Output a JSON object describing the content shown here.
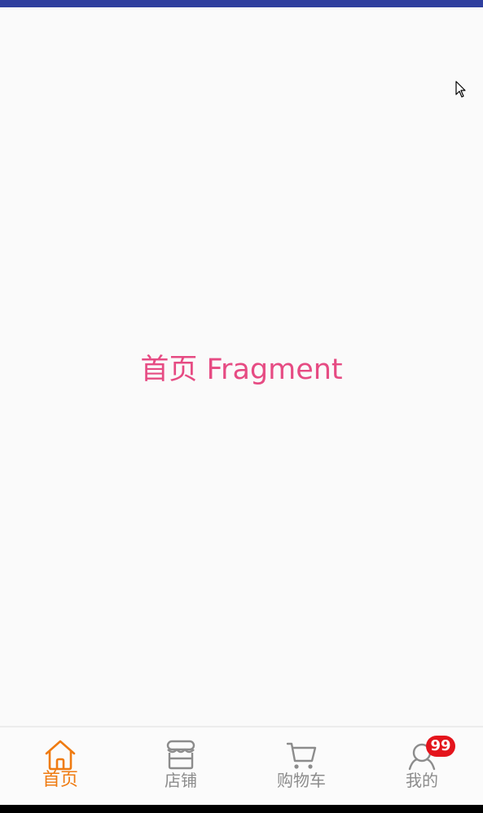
{
  "content": {
    "fragment_text": "首页 Fragment"
  },
  "bottom_nav": {
    "items": [
      {
        "label": "首页",
        "icon": "home-icon",
        "active": true
      },
      {
        "label": "店铺",
        "icon": "store-icon",
        "active": false
      },
      {
        "label": "购物车",
        "icon": "cart-icon",
        "active": false
      },
      {
        "label": "我的",
        "icon": "profile-icon",
        "active": false,
        "badge": "99"
      }
    ]
  },
  "colors": {
    "status_bar": "#2f3f9f",
    "fragment_text": "#e64b83",
    "nav_active": "#ef7b11",
    "nav_inactive": "#8c8c8c",
    "badge": "#e4141c"
  }
}
